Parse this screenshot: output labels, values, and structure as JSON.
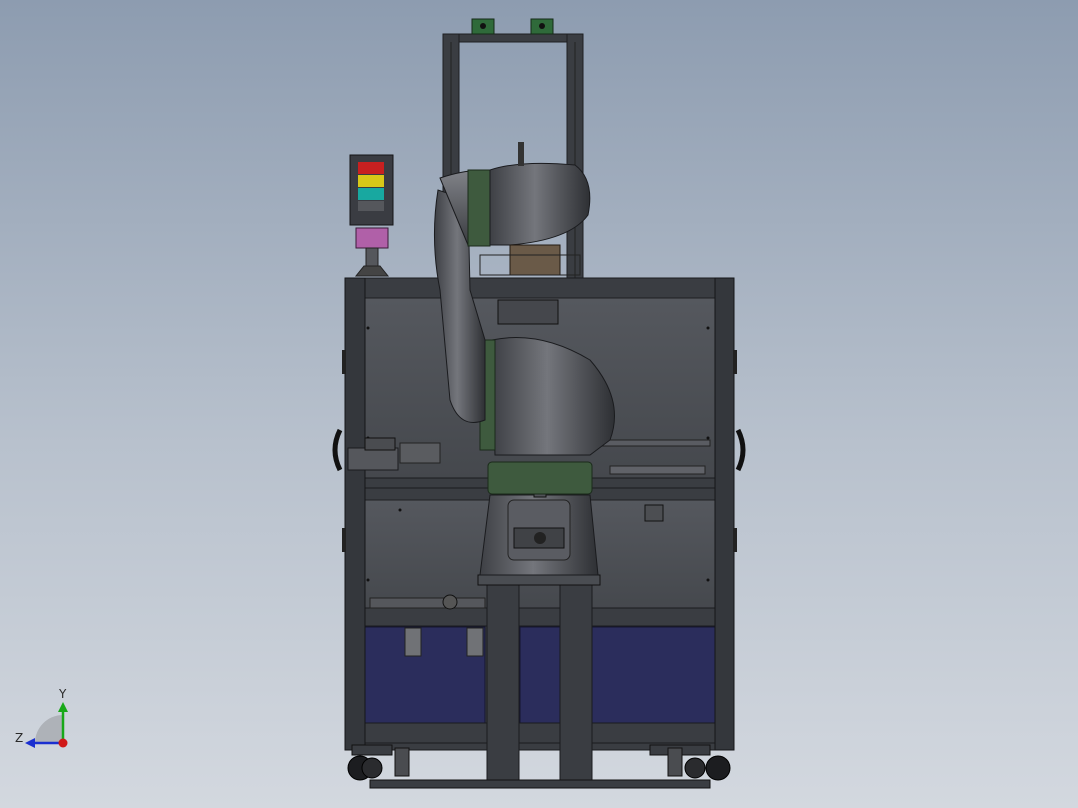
{
  "viewport": {
    "background_top": "#8d9cb0",
    "background_bottom": "#d3d8df"
  },
  "triad": {
    "y_label": "Y",
    "z_label": "Z",
    "y_color": "#18a818",
    "z_color": "#1a2fd0",
    "x_color": "#d01818"
  },
  "model": {
    "frame_color": "#3a3d42",
    "panel_color": "#4a4d52",
    "blue_panel_color": "#2b2d5c",
    "robot_color": "#5c5e63",
    "accent_green": "#3e5a3e",
    "stack_light_colors": [
      "#c82020",
      "#d8c818",
      "#18a8a0"
    ],
    "stand_color": "#b060a8"
  }
}
